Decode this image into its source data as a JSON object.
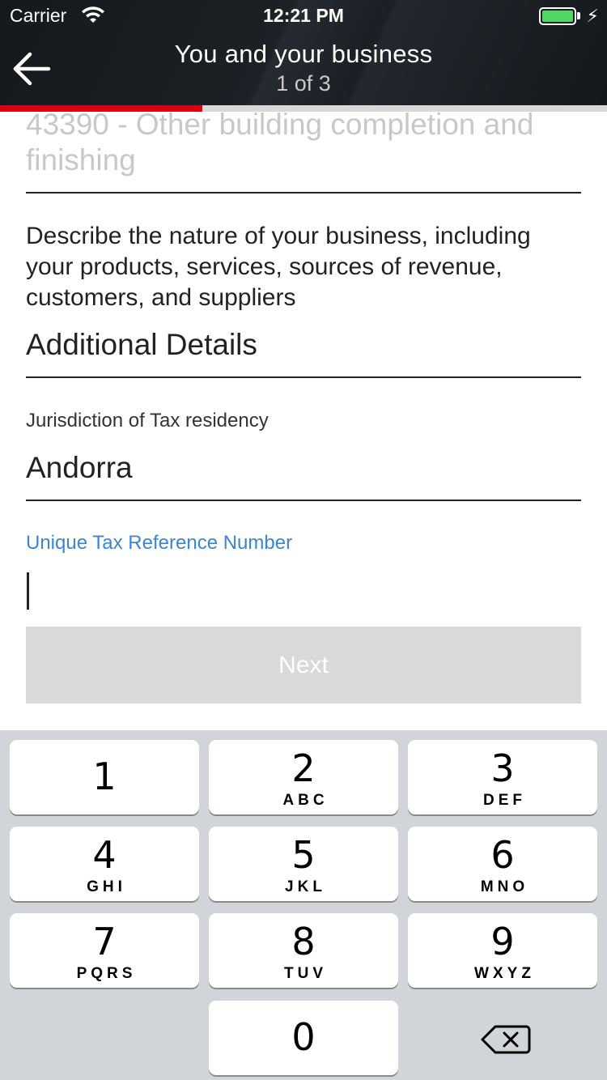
{
  "status_bar": {
    "carrier": "Carrier",
    "time": "12:21 PM"
  },
  "nav": {
    "title": "You and your business",
    "step": "1 of 3"
  },
  "progress": {
    "current_step": 1,
    "total_steps": 3,
    "color": "#db0011"
  },
  "form": {
    "business_activity_value": "43390 - Other building completion and finishing",
    "description_prompt": "Describe the nature of your business, including your products, services, sources of revenue, customers, and suppliers",
    "additional_details_value": "Additional Details",
    "tax_jurisdiction_label": "Jurisdiction of Tax residency",
    "tax_jurisdiction_value": "Andorra",
    "utr_label": "Unique Tax Reference Number",
    "utr_value": "",
    "next_label": "Next"
  },
  "keyboard": {
    "keys": [
      {
        "num": "1",
        "letters": ""
      },
      {
        "num": "2",
        "letters": "ABC"
      },
      {
        "num": "3",
        "letters": "DEF"
      },
      {
        "num": "4",
        "letters": "GHI"
      },
      {
        "num": "5",
        "letters": "JKL"
      },
      {
        "num": "6",
        "letters": "MNO"
      },
      {
        "num": "7",
        "letters": "PQRS"
      },
      {
        "num": "8",
        "letters": "TUV"
      },
      {
        "num": "9",
        "letters": "WXYZ"
      },
      {
        "num": "0",
        "letters": ""
      }
    ],
    "delete_icon": "backspace-icon"
  },
  "colors": {
    "accent_link": "#3a86d0",
    "button_disabled": "#d9d9d9",
    "header_bg": "#1b1f24"
  }
}
